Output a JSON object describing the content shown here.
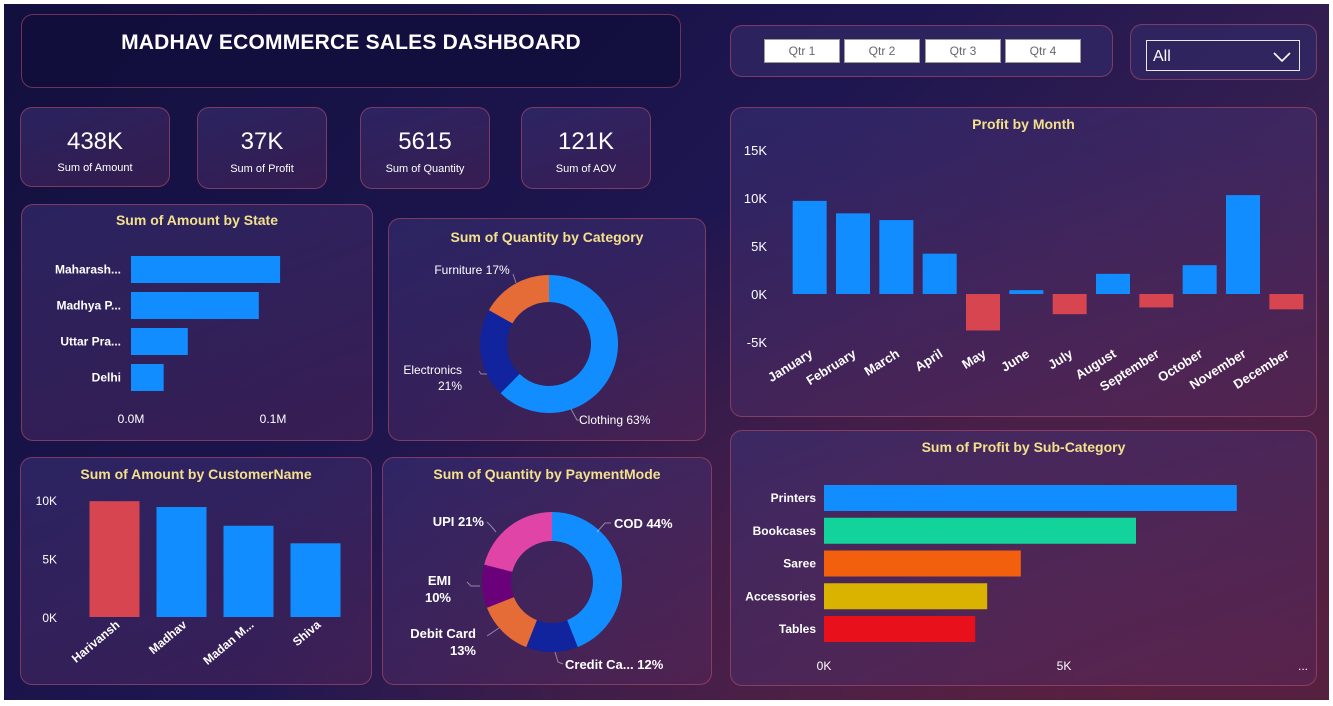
{
  "header": {
    "title": "MADHAV ECOMMERCE SALES DASHBOARD"
  },
  "slicer": {
    "quarters": [
      "Qtr 1",
      "Qtr 2",
      "Qtr 3",
      "Qtr 4"
    ],
    "selected": "All"
  },
  "kpis": [
    {
      "value": "438K",
      "label": "Sum of Amount"
    },
    {
      "value": "37K",
      "label": "Sum of Profit"
    },
    {
      "value": "5615",
      "label": "Sum of Quantity"
    },
    {
      "value": "121K",
      "label": "Sum of AOV"
    }
  ],
  "chart_data": [
    {
      "id": "amount_by_state",
      "type": "bar",
      "orientation": "horizontal",
      "title": "Sum of Amount by State",
      "categories": [
        "Maharash...",
        "Madhya P...",
        "Uttar Pra...",
        "Delhi"
      ],
      "values": [
        0.105,
        0.09,
        0.04,
        0.023
      ],
      "xticks": [
        "0.0M",
        "0.1M"
      ],
      "xlim": [
        0,
        0.1
      ],
      "color": "#118dff"
    },
    {
      "id": "quantity_by_category",
      "type": "pie",
      "donut": true,
      "title": "Sum of Quantity by Category",
      "labels": [
        "Clothing",
        "Electronics",
        "Furniture"
      ],
      "values": [
        63,
        21,
        17
      ],
      "label_text": [
        "Clothing 63%",
        "Electronics\n21%",
        "Furniture 17%"
      ],
      "colors": [
        "#118dff",
        "#12239e",
        "#e66c37"
      ]
    },
    {
      "id": "profit_by_month",
      "type": "bar",
      "title": "Profit by Month",
      "categories": [
        "January",
        "February",
        "March",
        "April",
        "May",
        "June",
        "July",
        "August",
        "September",
        "October",
        "November",
        "December"
      ],
      "values": [
        9700,
        8400,
        7700,
        4200,
        -3800,
        400,
        -2100,
        2100,
        -1400,
        3000,
        10300,
        -1600
      ],
      "ylim": [
        -5000,
        15000
      ],
      "yticks": [
        "-5K",
        "0K",
        "5K",
        "10K",
        "15K"
      ],
      "colors": {
        "positive": "#118dff",
        "negative": "#d64550"
      }
    },
    {
      "id": "amount_by_customer",
      "type": "bar",
      "title": "Sum of Amount by CustomerName",
      "categories": [
        "Harivansh",
        "Madhav",
        "Madan M...",
        "Shiva"
      ],
      "values": [
        9900,
        9400,
        7800,
        6300
      ],
      "ylim": [
        0,
        10000
      ],
      "yticks": [
        "0K",
        "5K",
        "10K"
      ],
      "colors": [
        "#d64550",
        "#118dff",
        "#118dff",
        "#118dff"
      ]
    },
    {
      "id": "quantity_by_paymentmode",
      "type": "pie",
      "donut": true,
      "title": "Sum of Quantity by PaymentMode",
      "labels": [
        "COD",
        "Credit Card",
        "Debit Card",
        "EMI",
        "UPI"
      ],
      "values": [
        44,
        12,
        13,
        10,
        21
      ],
      "label_text": [
        "COD 44%",
        "Credit Ca... 12%",
        "Debit Card\n13%",
        "EMI\n10%",
        "UPI 21%"
      ],
      "colors": [
        "#118dff",
        "#12239e",
        "#e66c37",
        "#6b007b",
        "#e044a7"
      ]
    },
    {
      "id": "profit_by_subcategory",
      "type": "bar",
      "orientation": "horizontal",
      "title": "Sum of Profit by Sub-Category",
      "categories": [
        "Printers",
        "Bookcases",
        "Saree",
        "Accessories",
        "Tables"
      ],
      "values": [
        8600,
        6500,
        4100,
        3400,
        3150
      ],
      "xticks": [
        "0K",
        "5K"
      ],
      "xlim": [
        0,
        5000
      ],
      "overflow_marker": "...",
      "colors": [
        "#118dff",
        "#12d399",
        "#f2600e",
        "#d9b300",
        "#e8101a"
      ]
    }
  ]
}
